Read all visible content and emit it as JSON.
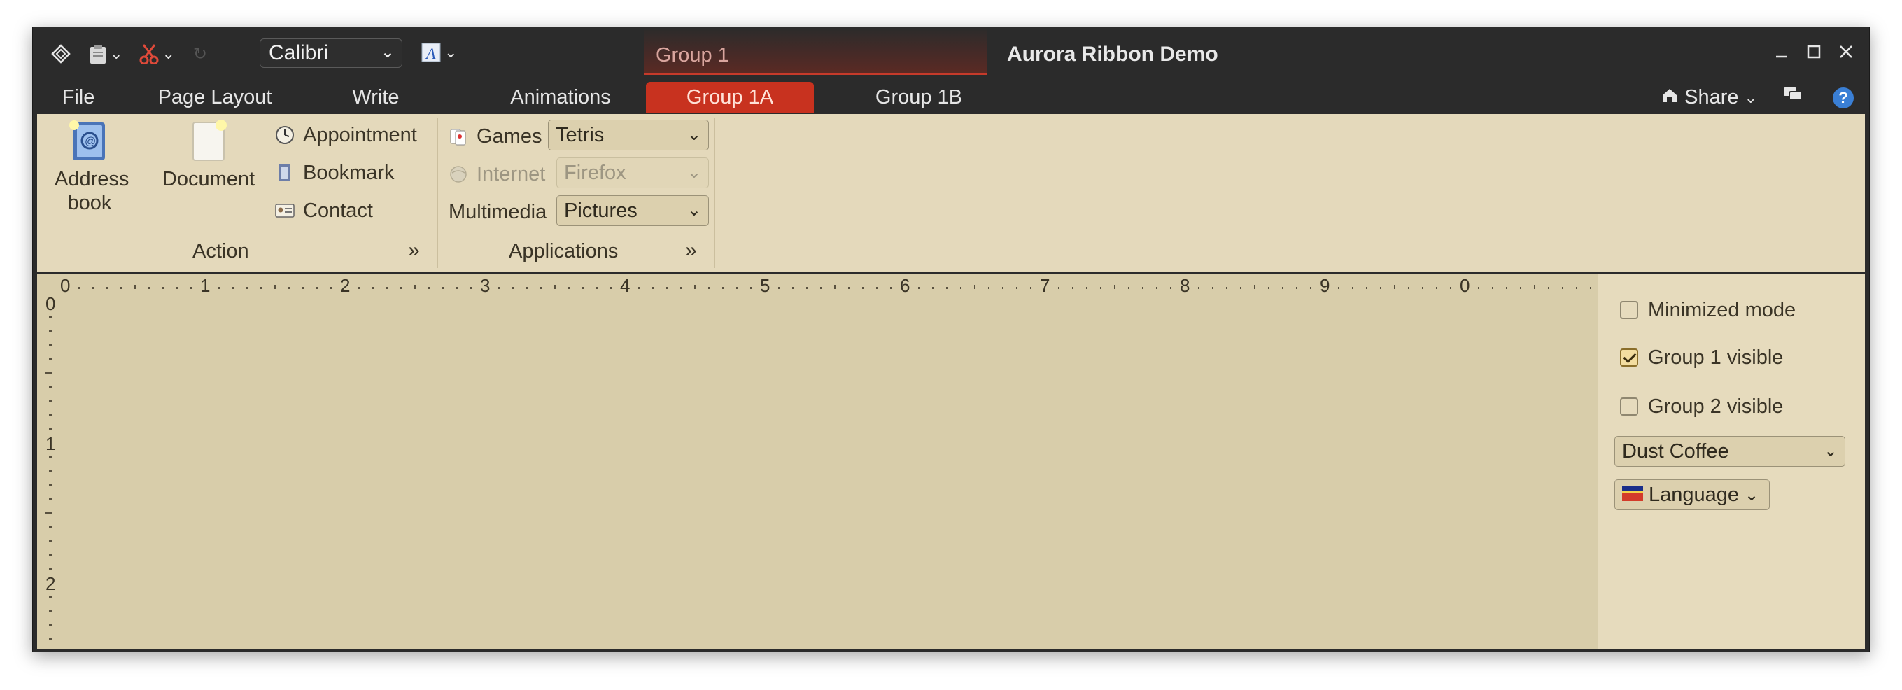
{
  "window": {
    "title": "Aurora Ribbon Demo",
    "contextual_group_label": "Group 1",
    "font_name": "Calibri"
  },
  "tabs": [
    {
      "label": "File"
    },
    {
      "label": "Page Layout"
    },
    {
      "label": "Write"
    },
    {
      "label": "Animations"
    },
    {
      "label": "Group 1A",
      "active": true
    },
    {
      "label": "Group 1B"
    }
  ],
  "right_controls": {
    "share_label": "Share",
    "help_glyph": "?"
  },
  "ribbon": {
    "action_group": {
      "label": "Action",
      "address_book_label": "Address book",
      "document_label": "Document",
      "appointment_label": "Appointment",
      "bookmark_label": "Bookmark",
      "contact_label": "Contact"
    },
    "applications_group": {
      "label": "Applications",
      "games_label": "Games",
      "games_value": "Tetris",
      "internet_label": "Internet",
      "internet_value": "Firefox",
      "multimedia_label": "Multimedia",
      "multimedia_value": "Pictures"
    }
  },
  "rulers": {
    "horizontal_labels": [
      "0",
      "1",
      "2",
      "3",
      "4",
      "5",
      "6",
      "7",
      "8",
      "9",
      "0"
    ],
    "vertical_labels": [
      "0",
      "1",
      "2"
    ]
  },
  "side_panel": {
    "minimized_mode_label": "Minimized mode",
    "minimized_mode_checked": false,
    "group1_visible_label": "Group 1 visible",
    "group1_visible_checked": true,
    "group2_visible_label": "Group 2 visible",
    "group2_visible_checked": false,
    "skin_value": "Dust Coffee",
    "language_label": "Language"
  },
  "colors": {
    "frame": "#2b2b2b",
    "ribbon": "#e4d9bb",
    "contextual_accent": "#c8321f"
  }
}
